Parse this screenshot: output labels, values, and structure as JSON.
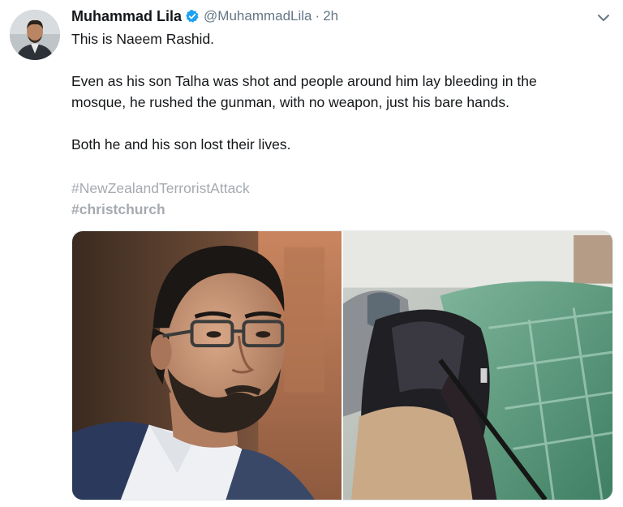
{
  "tweet": {
    "author": {
      "display_name": "Muhammad Lila",
      "handle": "@MuhammadLila",
      "verified": true,
      "avatar_icon": "profile-photo"
    },
    "separator": "·",
    "timestamp": "2h",
    "text": {
      "p1": "This is Naeem Rashid.",
      "p2_line1": "Even as his son Talha was shot and people around him lay bleeding in the",
      "p2_line2": "mosque, he rushed the gunman, with no weapon, just his bare hands.",
      "p3": "Both he and his son lost their lives."
    },
    "hashtags": [
      "#NewZealandTerroristAttack",
      "#christchurch"
    ],
    "media": {
      "count": 2,
      "items": [
        "portrait-photo",
        "video-still-photo"
      ]
    },
    "menu_icon": "chevron-down-icon"
  },
  "colors": {
    "text": "#14171a",
    "secondary": "#657786",
    "verified_badge": "#1da1f2",
    "hashtag_faded": "#a5aab0"
  }
}
